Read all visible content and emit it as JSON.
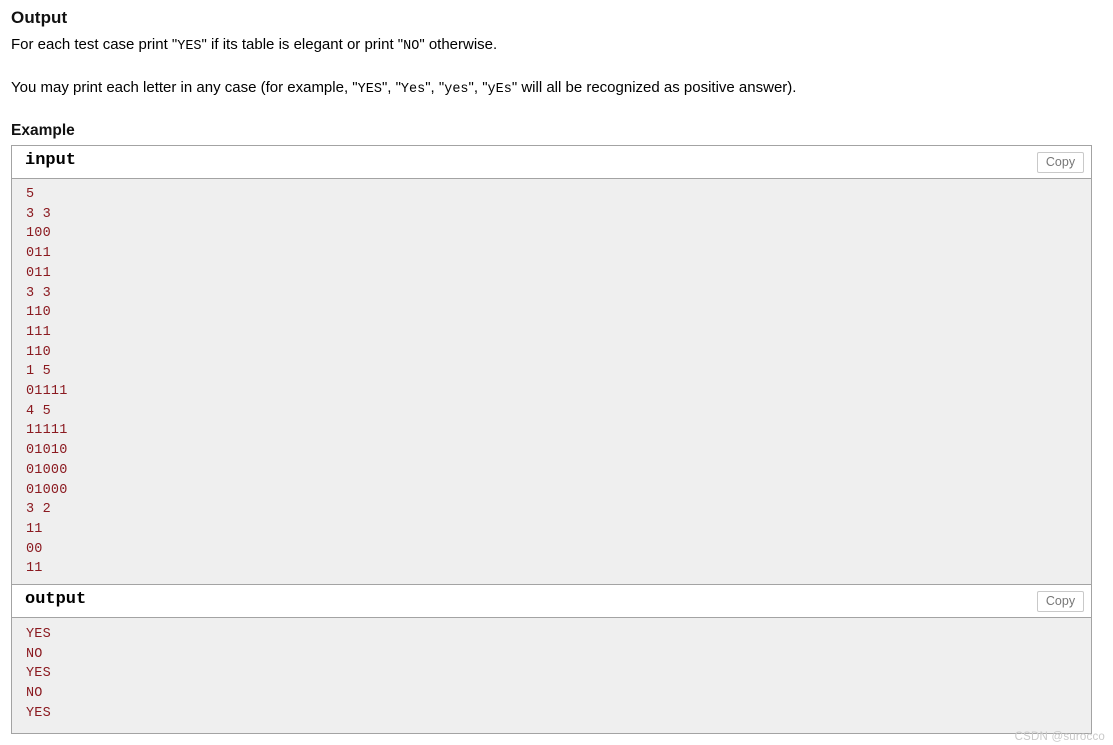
{
  "section": {
    "heading": "Output",
    "paragraph1": {
      "part1": "For each test case print \"",
      "code1": "YES",
      "part2": "\" if its table is elegant or print \"",
      "code2": "NO",
      "part3": "\" otherwise."
    },
    "paragraph2": {
      "part1": "You may print each letter in any case (for example, \"",
      "code1": "YES",
      "part2": "\", \"",
      "code2": "Yes",
      "part3": "\", \"",
      "code3": "yes",
      "part4": "\", \"",
      "code4": "yEs",
      "part5": "\" will all be recognized as positive answer)."
    }
  },
  "example": {
    "heading": "Example",
    "input_block": {
      "title": "input",
      "copy_label": "Copy",
      "lines": [
        "5",
        "3 3",
        "100",
        "011",
        "011",
        "3 3",
        "110",
        "111",
        "110",
        "1 5",
        "01111",
        "4 5",
        "11111",
        "01010",
        "01000",
        "01000",
        "3 2",
        "11",
        "00",
        "11"
      ]
    },
    "output_block": {
      "title": "output",
      "copy_label": "Copy",
      "lines": [
        "YES",
        "NO",
        "YES",
        "NO",
        "YES"
      ]
    }
  },
  "watermark": "CSDN @surocco",
  "colors": {
    "code_text": "#8b1a20",
    "code_bg": "#efefef",
    "border": "#a3a3a3",
    "copy_text": "#777777"
  }
}
